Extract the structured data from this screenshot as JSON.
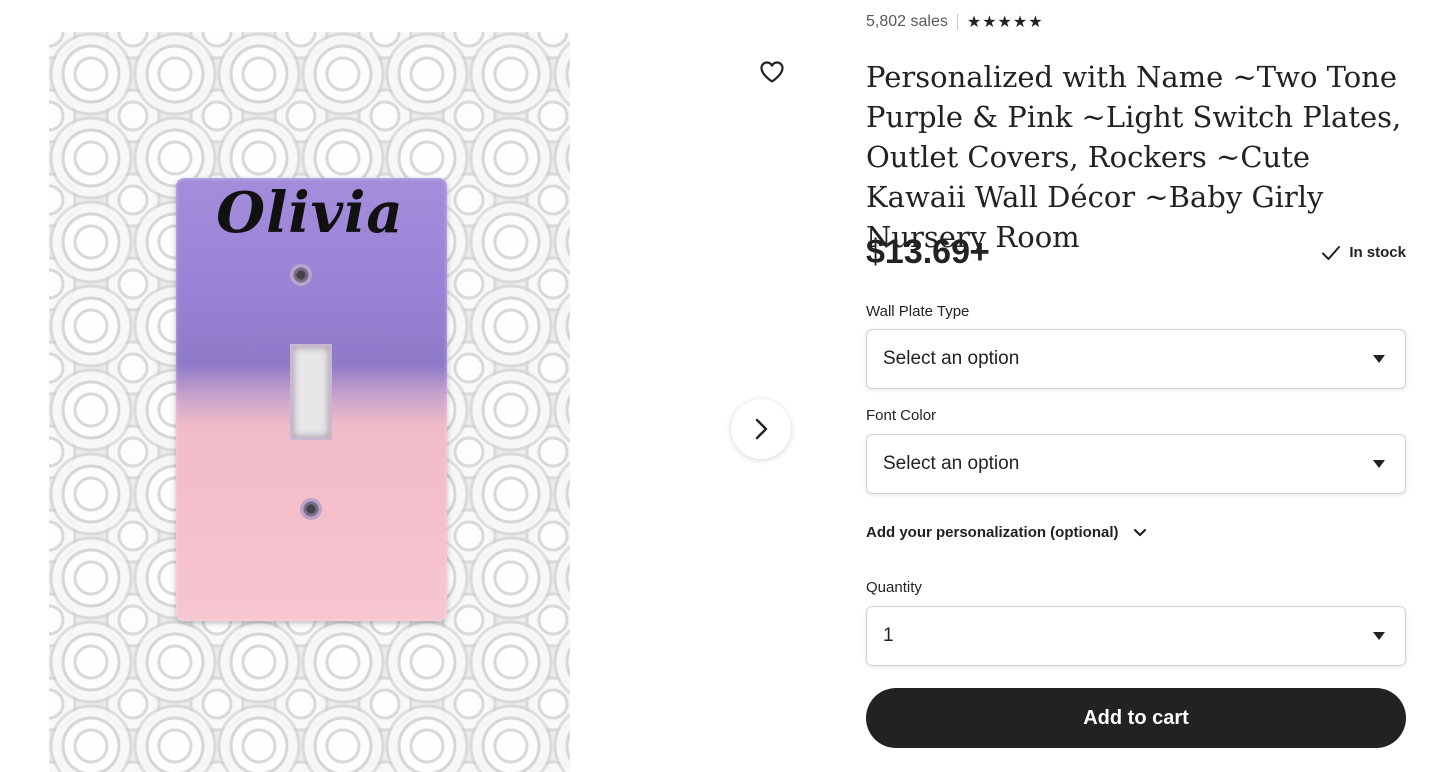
{
  "listing": {
    "shop_partial": "",
    "sales": "5,802 sales",
    "rating_stars": 5,
    "title": "Personalized with Name ~Two Tone Purple & Pink ~Light Switch Plates, Outlet Covers, Rockers ~Cute Kawaii Wall Décor ~Baby Girly Nursery Room",
    "price": "$13.69+",
    "stock_status": "In stock"
  },
  "image": {
    "plate_text": "Olivia",
    "icons": {
      "favorite": "heart-icon",
      "next": "chevron-right-icon"
    }
  },
  "options": {
    "wall_plate_type": {
      "label": "Wall Plate Type",
      "value": "Select an option"
    },
    "font_color": {
      "label": "Font Color",
      "value": "Select an option"
    },
    "personalization": "Add your personalization (optional)",
    "quantity": {
      "label": "Quantity",
      "value": "1"
    }
  },
  "actions": {
    "add_to_cart": "Add to cart"
  },
  "colors": {
    "accent": "#222222",
    "plate_purple": "#9a82d6",
    "plate_pink": "#f4bfcb"
  }
}
